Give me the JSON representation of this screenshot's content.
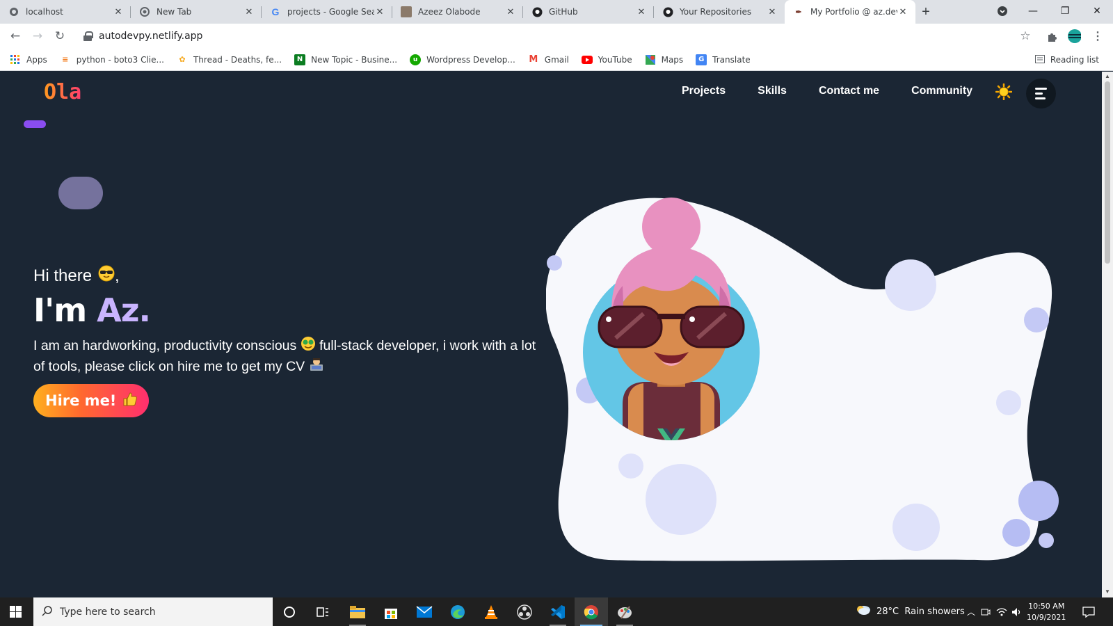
{
  "browser": {
    "tabs": [
      {
        "title": "localhost"
      },
      {
        "title": "New Tab"
      },
      {
        "title": "projects - Google Search"
      },
      {
        "title": "Azeez Olabode"
      },
      {
        "title": "GitHub"
      },
      {
        "title": "Your Repositories"
      },
      {
        "title": "My Portfolio @ az.dev",
        "active": true
      }
    ],
    "url": "autodevpy.netlify.app",
    "bookmarks": [
      {
        "label": "Apps",
        "icon": "apps-grid-icon"
      },
      {
        "label": "python - boto3 Clie...",
        "icon": "stackoverflow-icon"
      },
      {
        "label": "Thread - Deaths, fe...",
        "icon": "thread-icon"
      },
      {
        "label": "New Topic - Busine...",
        "icon": "nairaland-icon"
      },
      {
        "label": "Wordpress Develop...",
        "icon": "upwork-icon"
      },
      {
        "label": "Gmail",
        "icon": "gmail-icon"
      },
      {
        "label": "YouTube",
        "icon": "youtube-icon"
      },
      {
        "label": "Maps",
        "icon": "maps-icon"
      },
      {
        "label": "Translate",
        "icon": "translate-icon"
      }
    ],
    "reading_list": "Reading list"
  },
  "site": {
    "logo": "Ola",
    "nav": [
      "Projects",
      "Skills",
      "Contact me",
      "Community"
    ],
    "greeting": "Hi there",
    "greeting_suffix": ",",
    "headline_prefix": "I'm ",
    "headline_name": "Az.",
    "bio_part1": "I am an hardworking, productivity conscious",
    "bio_part2": "full-stack developer, i work with a lot of tools, please click on hire me to get my CV",
    "hire_label": "Hire me!",
    "accent": "#c9b4ff",
    "background": "#1b2634"
  },
  "taskbar": {
    "search_placeholder": "Type here to search",
    "weather": "28°C  Rain showers",
    "time": "10:50 AM",
    "date": "10/9/2021"
  }
}
